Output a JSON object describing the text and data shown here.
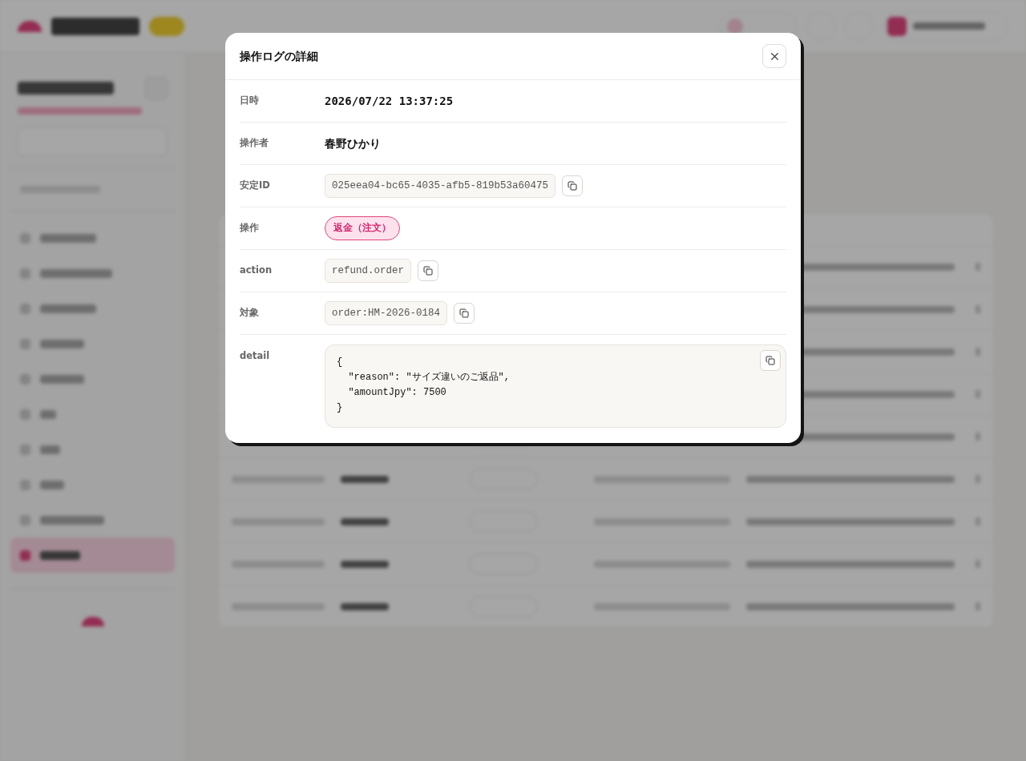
{
  "modal": {
    "title": "操作ログの詳細",
    "fields": [
      {
        "label": "日時",
        "kind": "datetime",
        "value": "2026/07/22 13:37:25",
        "copyable": false
      },
      {
        "label": "操作者",
        "kind": "strong",
        "value": "春野ひかり",
        "copyable": false
      },
      {
        "label": "安定ID",
        "kind": "code",
        "value": "025eea04-bc65-4035-afb5-819b53a60475",
        "copyable": true
      },
      {
        "label": "操作",
        "kind": "badge",
        "value": "返金（注文）",
        "copyable": false
      },
      {
        "label": "action",
        "kind": "code",
        "value": "refund.order",
        "copyable": true
      },
      {
        "label": "対象",
        "kind": "code",
        "value": "order:HM-2026-0184",
        "copyable": true
      },
      {
        "label": "detail",
        "kind": "json",
        "value": "{\n  \"reason\": \"サイズ違いのご返品\",\n  \"amountJpy\": 7500\n}",
        "copyable": true
      }
    ]
  }
}
